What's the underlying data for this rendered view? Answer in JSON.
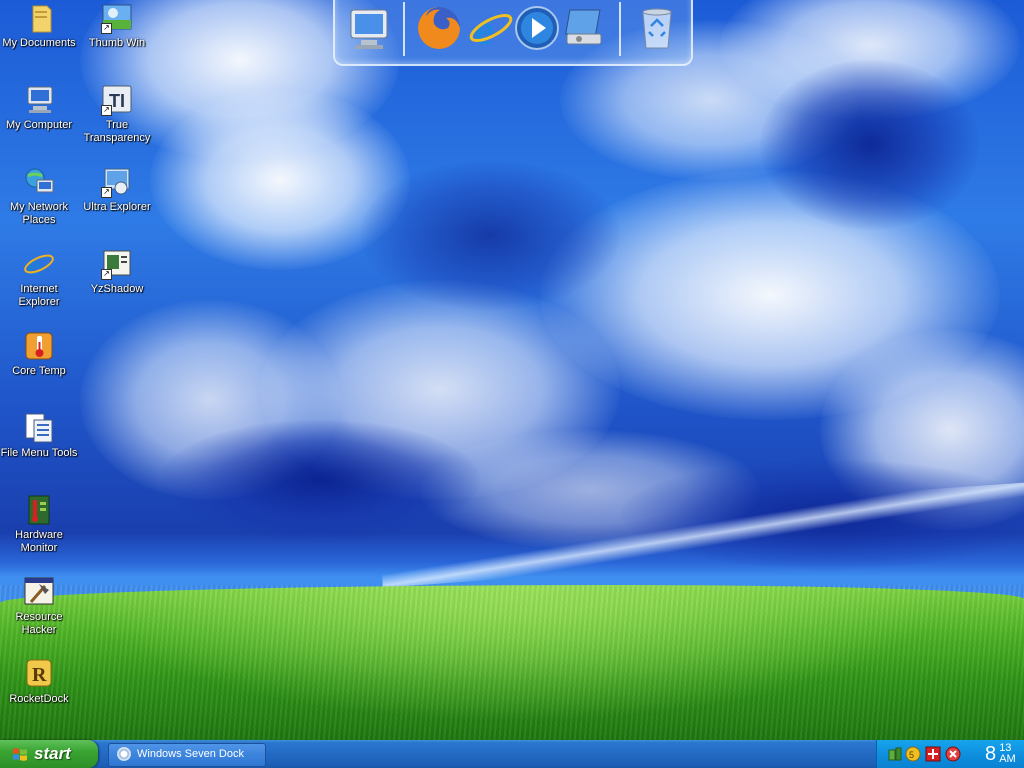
{
  "desktop": {
    "icons": [
      {
        "label": "My Documents",
        "icon": "folder-documents-icon"
      },
      {
        "label": "Thumb Win",
        "icon": "thumb-win-icon"
      },
      {
        "label": "My Computer",
        "icon": "my-computer-icon"
      },
      {
        "label": "True Transparency",
        "icon": "true-transparency-icon"
      },
      {
        "label": "My Network Places",
        "icon": "network-places-icon"
      },
      {
        "label": "Ultra Explorer",
        "icon": "ultra-explorer-icon"
      },
      {
        "label": "Internet Explorer",
        "icon": "internet-explorer-icon"
      },
      {
        "label": "YzShadow",
        "icon": "yzshadow-icon"
      },
      {
        "label": "Core Temp",
        "icon": "core-temp-icon"
      },
      {
        "label": "File Menu Tools",
        "icon": "file-menu-tools-icon"
      },
      {
        "label": "Hardware Monitor",
        "icon": "hardware-monitor-icon"
      },
      {
        "label": "Resource Hacker",
        "icon": "resource-hacker-icon"
      },
      {
        "label": "RocketDock",
        "icon": "rocketdock-icon"
      }
    ]
  },
  "dock": {
    "items": [
      {
        "name": "my-computer-dock-icon"
      },
      {
        "name": "firefox-icon"
      },
      {
        "name": "internet-explorer-dock-icon"
      },
      {
        "name": "media-player-icon"
      },
      {
        "name": "control-panel-icon"
      },
      {
        "name": "recycle-bin-icon"
      }
    ]
  },
  "taskbar": {
    "start_label": "start",
    "tasks": [
      {
        "label": "Windows Seven Dock"
      }
    ],
    "clock": {
      "hour": "8",
      "minutes": "13",
      "ampm": "AM"
    }
  },
  "colors": {
    "taskbar": "#236ac3",
    "start": "#3aa533",
    "tray": "#0f90e0"
  }
}
